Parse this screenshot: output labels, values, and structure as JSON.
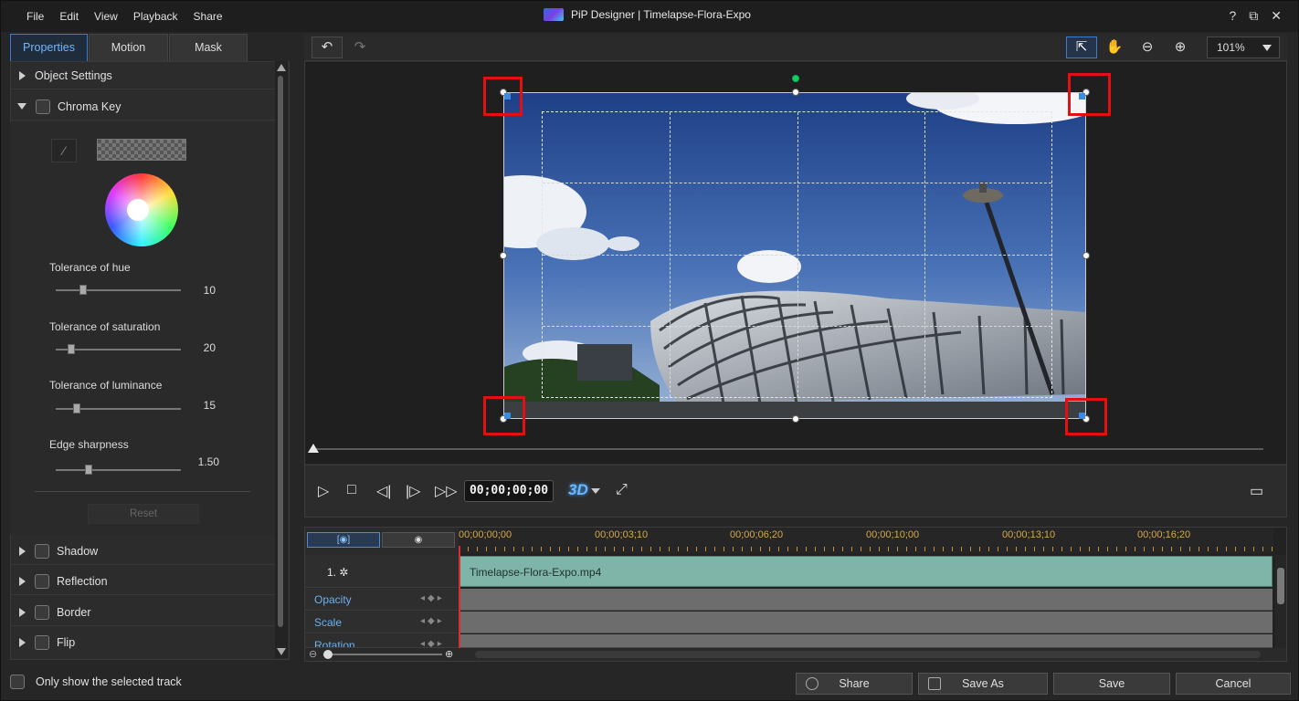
{
  "menu": [
    "File",
    "Edit",
    "View",
    "Playback",
    "Share"
  ],
  "window": {
    "title": "PiP Designer  |  Timelapse-Flora-Expo",
    "help": "?",
    "restore": "⧉",
    "close": "✕"
  },
  "tabs": [
    "Properties",
    "Motion",
    "Mask"
  ],
  "sections": {
    "object_settings": "Object Settings",
    "chroma_key": "Chroma Key",
    "shadow": "Shadow",
    "reflection": "Reflection",
    "border": "Border",
    "flip": "Flip"
  },
  "chroma": {
    "sliders": [
      {
        "label": "Tolerance of hue",
        "value": "10",
        "fraction": 0.2
      },
      {
        "label": "Tolerance of saturation",
        "value": "20",
        "fraction": 0.1
      },
      {
        "label": "Tolerance of luminance",
        "value": "15",
        "fraction": 0.15
      },
      {
        "label": "Edge sharpness",
        "value": "1.50",
        "fraction": 0.25
      }
    ],
    "reset_label": "Reset"
  },
  "only_selected_track": "Only show the selected track",
  "preview": {
    "zoom": "101%",
    "timecode": "00;00;00;00",
    "mode_3d": "3D"
  },
  "timeline": {
    "ruler": [
      "00;00;00;00",
      "00;00;03;10",
      "00;00;06;20",
      "00;00;10;00",
      "00;00;13;10",
      "00;00;16;20"
    ],
    "track_label": "1. ✲",
    "clip_name": "Timelapse-Flora-Expo.mp4",
    "props": [
      "Opacity",
      "Scale",
      "Rotation"
    ]
  },
  "buttons": {
    "share": "Share",
    "save_as": "Save As",
    "save": "Save",
    "cancel": "Cancel"
  },
  "colors": {
    "accent": "#3d7bd0",
    "highlight_box": "#e40f14",
    "clip": "#7fb4a8"
  }
}
